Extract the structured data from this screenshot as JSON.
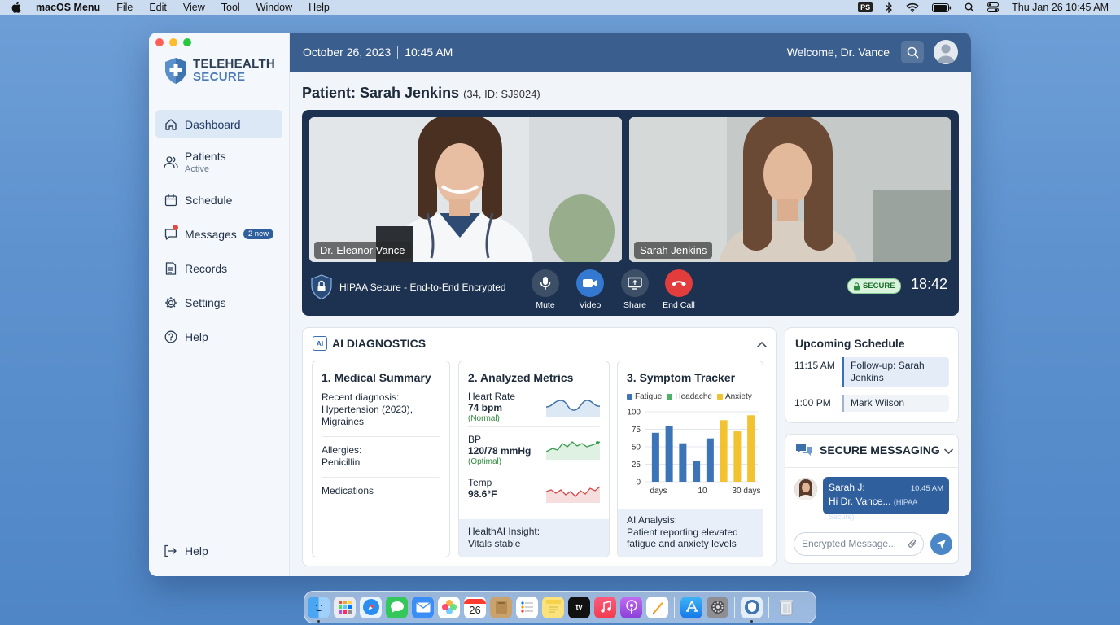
{
  "menubar": {
    "app_menu": "macOS Menu",
    "items": [
      "File",
      "Edit",
      "View",
      "Tool",
      "Window",
      "Help"
    ],
    "ps_badge": "PS",
    "clock": "Thu Jan 26  10:45 AM"
  },
  "sidebar": {
    "logo_line1": "TELEHEALTH",
    "logo_line2": "SECURE",
    "items": [
      {
        "label": "Dashboard",
        "icon": "home-icon"
      },
      {
        "label": "Patients",
        "sub": "Active",
        "icon": "users-icon"
      },
      {
        "label": "Schedule",
        "icon": "calendar-icon"
      },
      {
        "label": "Messages",
        "badge": "2 new",
        "icon": "message-icon"
      },
      {
        "label": "Records",
        "icon": "document-icon"
      },
      {
        "label": "Settings",
        "icon": "gear-icon"
      },
      {
        "label": "Help",
        "icon": "question-icon"
      }
    ],
    "bottom_help": "Help"
  },
  "topbar": {
    "date": "October 26, 2023",
    "time": "10:45 AM",
    "welcome": "Welcome, Dr. Vance"
  },
  "patient": {
    "title": "Patient: Sarah Jenkins",
    "meta": "(34, ID: SJ9024)"
  },
  "call": {
    "doctor_label": "Dr. Eleanor Vance",
    "patient_label": "Sarah Jenkins",
    "security_text": "HIPAA Secure - End-to-End Encrypted",
    "controls": [
      "Mute",
      "Video",
      "Share",
      "End Call"
    ],
    "secure_badge": "SECURE",
    "timer": "18:42"
  },
  "ai": {
    "title": "AI DIAGNOSTICS",
    "chip": "AI",
    "summary": {
      "title": "1. Medical Summary",
      "diagnosis_label": "Recent diagnosis:",
      "diagnosis_value": "Hypertension (2023), Migraines",
      "allergies_label": "Allergies:",
      "allergies_value": "Penicillin",
      "medications_label": "Medications"
    },
    "metrics": {
      "title": "2. Analyzed Metrics",
      "items": [
        {
          "label": "Heart Rate",
          "value": "74 bpm",
          "status": "(Normal)"
        },
        {
          "label": "BP",
          "value": "120/78 mmHg",
          "status": "(Optimal)"
        },
        {
          "label": "Temp",
          "value": "98.6°F",
          "status": ""
        }
      ],
      "insight_label": "HealthAI Insight:",
      "insight_value": "Vitals stable"
    },
    "tracker": {
      "title": "3. Symptom Tracker",
      "analysis_label": "AI Analysis:",
      "analysis_value": "Patient reporting elevated fatigue and anxiety levels"
    }
  },
  "chart_data": {
    "type": "bar",
    "series": [
      {
        "name": "Fatigue",
        "color": "#3d74b8",
        "values": [
          70,
          80,
          55,
          30,
          62
        ]
      },
      {
        "name": "Headache",
        "color": "#4cb26a",
        "values": []
      },
      {
        "name": "Anxiety",
        "color": "#f2c230",
        "values": [
          88,
          72,
          95
        ]
      }
    ],
    "fatigue_x": [
      1,
      2,
      3,
      4,
      5
    ],
    "anxiety_x": [
      6,
      7,
      8
    ],
    "ylim": [
      0,
      100
    ],
    "yticks": [
      0,
      25,
      50,
      75,
      100
    ],
    "xtick_labels": [
      "days",
      "10",
      "30 days"
    ],
    "grid": true,
    "legend": "top"
  },
  "schedule": {
    "title": "Upcoming Schedule",
    "items": [
      {
        "time": "11:15 AM",
        "event": "Follow-up: Sarah Jenkins"
      },
      {
        "time": "1:00 PM",
        "event": "Mark Wilson"
      }
    ]
  },
  "messaging": {
    "title": "SECURE MESSAGING",
    "sender": "Sarah J:",
    "time": "10:45 AM",
    "text": "Hi Dr. Vance...",
    "tag": "(HIPAA Secure)",
    "placeholder": "Encrypted Message..."
  },
  "dock": {
    "calendar_day": "26",
    "apps": [
      "finder-icon",
      "launchpad-icon",
      "safari-icon",
      "messages-icon",
      "mail-icon",
      "photos-icon",
      "calendar-icon",
      "notes-icon",
      "reminders-icon",
      "stickies-icon",
      "appletv-icon",
      "music-icon",
      "podcasts-icon",
      "pages-icon",
      "appstore-icon",
      "system-settings-icon",
      "telehealth-icon",
      "trash-icon"
    ]
  }
}
